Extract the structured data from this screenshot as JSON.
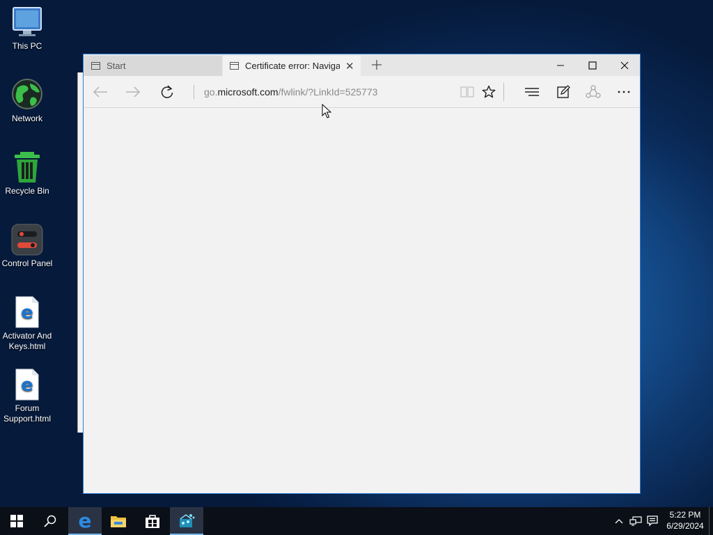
{
  "desktop": {
    "icons": [
      {
        "label": "This PC",
        "icon": "monitor-icon"
      },
      {
        "label": "Network",
        "icon": "globe-icon"
      },
      {
        "label": "Recycle Bin",
        "icon": "recycle-bin-icon"
      },
      {
        "label": "Control Panel",
        "icon": "control-panel-icon"
      },
      {
        "label": "Activator And Keys.html",
        "label_line1": "Activator And",
        "label_line2": "Keys.html",
        "icon": "edge-document-icon"
      },
      {
        "label": "Forum Support.html",
        "label_line1": "Forum",
        "label_line2": "Support.html",
        "icon": "edge-document-icon"
      }
    ]
  },
  "browser": {
    "tabs": [
      {
        "title": "Start",
        "active": false
      },
      {
        "title": "Certificate error: Navigat",
        "active": true
      }
    ],
    "address": {
      "prefix": "go.",
      "domain": "microsoft.com",
      "path": "/fwlink/?LinkId=525773"
    },
    "accent_color": "#2b7bd3"
  },
  "taskbar": {
    "items": [
      "start-button",
      "search-button",
      "edge-app",
      "file-explorer-app",
      "store-app",
      "app-icon"
    ],
    "clock": {
      "time": "5:22 PM",
      "date": "6/29/2024"
    }
  }
}
